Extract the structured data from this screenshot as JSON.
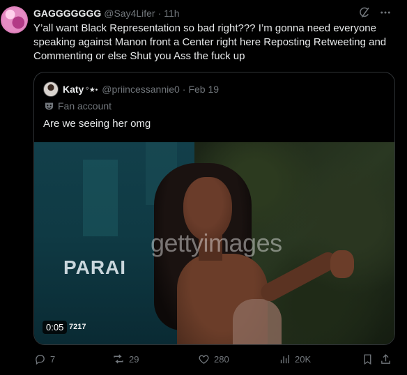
{
  "tweet": {
    "display_name": "GAGGGGGGG",
    "handle": "@Say4Lifer",
    "separator": "·",
    "time": "11h",
    "text": "Y’all want Black Representation so bad right??? I’m gonna need everyone speaking against Manon front a Center right here Reposting Retweeting and Commenting or else Shut you Ass the fuck up"
  },
  "quote": {
    "display_name": "Katy ",
    "badge": "꙳★•",
    "handle": "@priincessannie0",
    "separator": "·",
    "date": "Feb 19",
    "label": "Fan account",
    "text": "Are we seeing her omg",
    "media": {
      "watermark": "gettyimages",
      "watermark_id": "7217",
      "backdrop_text": "PARAI",
      "timer": "0:05"
    }
  },
  "actions": {
    "replies": "7",
    "reposts": "29",
    "likes": "280",
    "views": "20K"
  },
  "icons": [
    "avatar",
    "grok-icon",
    "more-icon",
    "mask-icon",
    "reply-icon",
    "repost-icon",
    "like-icon",
    "views-icon",
    "bookmark-icon",
    "share-icon"
  ],
  "colors": {
    "background": "#000000",
    "text": "#e7e9ea",
    "muted": "#71767b",
    "border": "#2f3336"
  }
}
